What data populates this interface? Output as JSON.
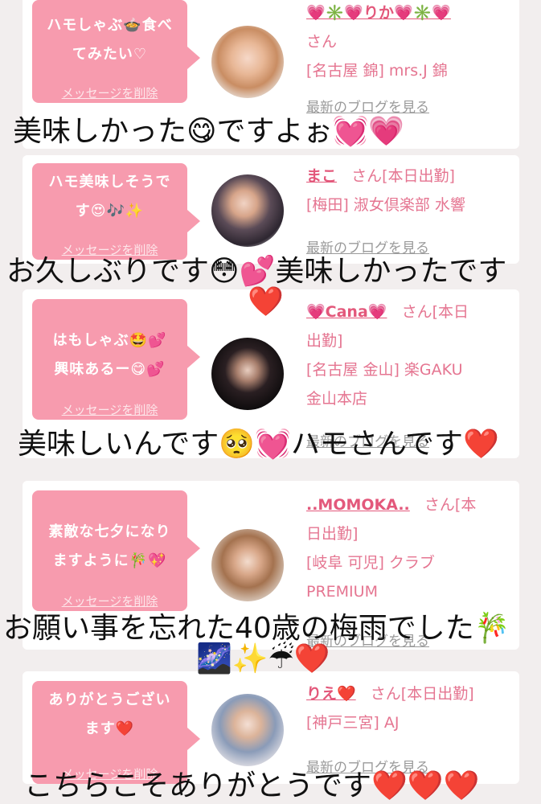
{
  "delete_label": "メッセージを削除",
  "blog_label": "最新のブログを見る",
  "san_label": "さん",
  "colors": {
    "bubble": "#f79bae",
    "text_pink": "#e57591",
    "name_pink": "#e3587b",
    "heart_red": "#e0102d"
  },
  "cards": [
    {
      "bubble_line1": "ハモしゃぶ🍲食べ",
      "bubble_line2": "てみたい♡",
      "name": "💗✳️💗りか💗✳️💗",
      "line2": "さん",
      "line3": "[名古屋 錦] mrs.J 錦",
      "caption": "美味しかった😋ですよぉ💓💗"
    },
    {
      "bubble_line1": "ハモ美味しそうで",
      "bubble_line2": "す😍🎶✨",
      "name": "まこ",
      "name_suffix": "さん[本日出勤]",
      "line2": "[梅田] 淑女倶楽部 水響",
      "caption_line1": "お久しぶりです😳💕美味しかったです",
      "caption_line2": "❤️"
    },
    {
      "bubble_line1": "はもしゃぶ🤩💕",
      "bubble_line2": "興味あるー😋💕",
      "name": "💗Cana💗",
      "name_suffix": "さん[本日",
      "line2": "出勤]",
      "line3": "[名古屋 金山] 楽GAKU",
      "line4": "金山本店",
      "caption": "美味しいんです🥺💓ハモさんです❤️"
    },
    {
      "bubble_line1": "素敵な七夕になり",
      "bubble_line2": "ますように🎋💖",
      "name": "..MOMOKA..",
      "name_suffix": "さん[本",
      "line2": "日出勤]",
      "line3": "[岐阜 可児] クラブ",
      "line4": "PREMIUM",
      "caption_line1": "お願い事を忘れた40歳の梅雨でした🎋",
      "caption_line2": "🌌✨☔❤️"
    },
    {
      "bubble_line1": "ありがとうござい",
      "bubble_line2": "ます❤️",
      "name": "りえ❤️",
      "name_suffix": "さん[本日出勤]",
      "line2": "[神戸三宮] AJ",
      "caption": "こちらこそありがとうです❤️❤️❤️"
    }
  ]
}
